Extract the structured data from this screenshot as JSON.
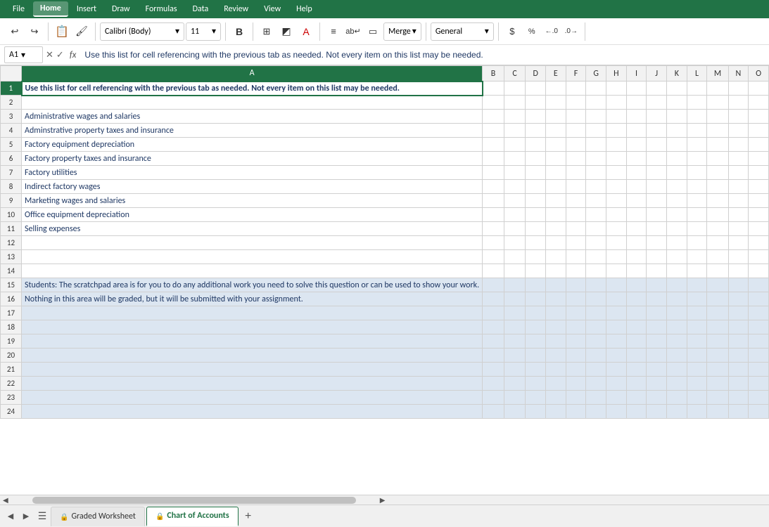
{
  "menuBar": {
    "items": [
      "File",
      "Home",
      "Insert",
      "Draw",
      "Formulas",
      "Data",
      "Review",
      "View",
      "Help"
    ],
    "active": "Home"
  },
  "toolbar": {
    "undo_icon": "↩",
    "redo_icon": "↪",
    "clipboard_icon": "📋",
    "format_painter_icon": "🖌",
    "font_name": "Calibri (Body)",
    "font_size": "11",
    "bold_label": "B",
    "grid_icon": "⊞",
    "highlight_icon": "A",
    "text_color_icon": "A",
    "align_icon": "≡",
    "wrap_icon": "ab",
    "cell_icon": "▭",
    "merge_label": "Merge",
    "format_label": "General",
    "dollar_icon": "$",
    "pct_icon": "%",
    "decimal_icon": ".00"
  },
  "formulaBar": {
    "cellRef": "A1",
    "dropdownIcon": "▾",
    "cancelIcon": "✕",
    "confirmIcon": "✓",
    "fxLabel": "fx",
    "formula": "Use this list for cell referencing with the previous tab as needed. Not every item on this list may be needed."
  },
  "columns": {
    "rowHeader": "",
    "headers": [
      "A",
      "B",
      "C",
      "D",
      "E",
      "F",
      "G",
      "H",
      "I",
      "J",
      "K",
      "L",
      "M",
      "N",
      "O"
    ]
  },
  "rows": [
    {
      "rowNum": "1",
      "isInstruction": true,
      "cells": {
        "A": "Use this list for cell referencing with the previous tab as needed. Not every item on this list may be needed.",
        "B": "",
        "C": "",
        "D": "",
        "E": "",
        "F": "",
        "G": "",
        "H": "",
        "I": "",
        "J": "",
        "K": "",
        "L": "",
        "M": "",
        "N": "",
        "O": ""
      }
    },
    {
      "rowNum": "2",
      "cells": {
        "A": "",
        "B": "",
        "C": "",
        "D": "",
        "E": "",
        "F": "",
        "G": "",
        "H": "",
        "I": "",
        "J": "",
        "K": "",
        "L": "",
        "M": "",
        "N": "",
        "O": ""
      }
    },
    {
      "rowNum": "3",
      "cells": {
        "A": "Administrative wages and salaries",
        "B": "",
        "C": "",
        "D": "",
        "E": "",
        "F": "",
        "G": "",
        "H": "",
        "I": "",
        "J": "",
        "K": "",
        "L": "",
        "M": "",
        "N": "",
        "O": ""
      }
    },
    {
      "rowNum": "4",
      "cells": {
        "A": "Adminstrative property taxes and insurance",
        "B": "",
        "C": "",
        "D": "",
        "E": "",
        "F": "",
        "G": "",
        "H": "",
        "I": "",
        "J": "",
        "K": "",
        "L": "",
        "M": "",
        "N": "",
        "O": ""
      }
    },
    {
      "rowNum": "5",
      "cells": {
        "A": "Factory equipment depreciation",
        "B": "",
        "C": "",
        "D": "",
        "E": "",
        "F": "",
        "G": "",
        "H": "",
        "I": "",
        "J": "",
        "K": "",
        "L": "",
        "M": "",
        "N": "",
        "O": ""
      }
    },
    {
      "rowNum": "6",
      "cells": {
        "A": "Factory property taxes and insurance",
        "B": "",
        "C": "",
        "D": "",
        "E": "",
        "F": "",
        "G": "",
        "H": "",
        "I": "",
        "J": "",
        "K": "",
        "L": "",
        "M": "",
        "N": "",
        "O": ""
      }
    },
    {
      "rowNum": "7",
      "cells": {
        "A": "Factory utilities",
        "B": "",
        "C": "",
        "D": "",
        "E": "",
        "F": "",
        "G": "",
        "H": "",
        "I": "",
        "J": "",
        "K": "",
        "L": "",
        "M": "",
        "N": "",
        "O": ""
      }
    },
    {
      "rowNum": "8",
      "cells": {
        "A": "Indirect factory wages",
        "B": "",
        "C": "",
        "D": "",
        "E": "",
        "F": "",
        "G": "",
        "H": "",
        "I": "",
        "J": "",
        "K": "",
        "L": "",
        "M": "",
        "N": "",
        "O": ""
      }
    },
    {
      "rowNum": "9",
      "cells": {
        "A": "Marketing wages and salaries",
        "B": "",
        "C": "",
        "D": "",
        "E": "",
        "F": "",
        "G": "",
        "H": "",
        "I": "",
        "J": "",
        "K": "",
        "L": "",
        "M": "",
        "N": "",
        "O": ""
      }
    },
    {
      "rowNum": "10",
      "cells": {
        "A": "Office equipment depreciation",
        "B": "",
        "C": "",
        "D": "",
        "E": "",
        "F": "",
        "G": "",
        "H": "",
        "I": "",
        "J": "",
        "K": "",
        "L": "",
        "M": "",
        "N": "",
        "O": ""
      }
    },
    {
      "rowNum": "11",
      "cells": {
        "A": "Selling expenses",
        "B": "",
        "C": "",
        "D": "",
        "E": "",
        "F": "",
        "G": "",
        "H": "",
        "I": "",
        "J": "",
        "K": "",
        "L": "",
        "M": "",
        "N": "",
        "O": ""
      }
    },
    {
      "rowNum": "12",
      "cells": {
        "A": "",
        "B": "",
        "C": "",
        "D": "",
        "E": "",
        "F": "",
        "G": "",
        "H": "",
        "I": "",
        "J": "",
        "K": "",
        "L": "",
        "M": "",
        "N": "",
        "O": ""
      }
    },
    {
      "rowNum": "13",
      "cells": {
        "A": "",
        "B": "",
        "C": "",
        "D": "",
        "E": "",
        "F": "",
        "G": "",
        "H": "",
        "I": "",
        "J": "",
        "K": "",
        "L": "",
        "M": "",
        "N": "",
        "O": ""
      }
    },
    {
      "rowNum": "14",
      "cells": {
        "A": "",
        "B": "",
        "C": "",
        "D": "",
        "E": "",
        "F": "",
        "G": "",
        "H": "",
        "I": "",
        "J": "",
        "K": "",
        "L": "",
        "M": "",
        "N": "",
        "O": ""
      }
    },
    {
      "rowNum": "15",
      "isScratchpad": true,
      "cells": {
        "A": "Students: The scratchpad area is for you to do any additional work you need to solve this question or can be used to show your work.",
        "B": "",
        "C": "",
        "D": "",
        "E": "",
        "F": "",
        "G": "",
        "H": "",
        "I": "",
        "J": "",
        "K": "",
        "L": "",
        "M": "",
        "N": "",
        "O": ""
      }
    },
    {
      "rowNum": "16",
      "isScratchpad": true,
      "cells": {
        "A": "Nothing in this area will be graded, but it will be submitted with your assignment.",
        "B": "",
        "C": "",
        "D": "",
        "E": "",
        "F": "",
        "G": "",
        "H": "",
        "I": "",
        "J": "",
        "K": "",
        "L": "",
        "M": "",
        "N": "",
        "O": ""
      }
    },
    {
      "rowNum": "17",
      "isScratchpadEmpty": true,
      "cells": {
        "A": "",
        "B": "",
        "C": "",
        "D": "",
        "E": "",
        "F": "",
        "G": "",
        "H": "",
        "I": "",
        "J": "",
        "K": "",
        "L": "",
        "M": "",
        "N": "",
        "O": ""
      }
    },
    {
      "rowNum": "18",
      "isScratchpadEmpty": true,
      "cells": {
        "A": "",
        "B": "",
        "C": "",
        "D": "",
        "E": "",
        "F": "",
        "G": "",
        "H": "",
        "I": "",
        "J": "",
        "K": "",
        "L": "",
        "M": "",
        "N": "",
        "O": ""
      }
    },
    {
      "rowNum": "19",
      "isScratchpadEmpty": true,
      "cells": {
        "A": "",
        "B": "",
        "C": "",
        "D": "",
        "E": "",
        "F": "",
        "G": "",
        "H": "",
        "I": "",
        "J": "",
        "K": "",
        "L": "",
        "M": "",
        "N": "",
        "O": ""
      }
    },
    {
      "rowNum": "20",
      "isScratchpadEmpty": true,
      "cells": {
        "A": "",
        "B": "",
        "C": "",
        "D": "",
        "E": "",
        "F": "",
        "G": "",
        "H": "",
        "I": "",
        "J": "",
        "K": "",
        "L": "",
        "M": "",
        "N": "",
        "O": ""
      }
    },
    {
      "rowNum": "21",
      "isScratchpadEmpty": true,
      "cells": {
        "A": "",
        "B": "",
        "C": "",
        "D": "",
        "E": "",
        "F": "",
        "G": "",
        "H": "",
        "I": "",
        "J": "",
        "K": "",
        "L": "",
        "M": "",
        "N": "",
        "O": ""
      }
    },
    {
      "rowNum": "22",
      "isScratchpadEmpty": true,
      "cells": {
        "A": "",
        "B": "",
        "C": "",
        "D": "",
        "E": "",
        "F": "",
        "G": "",
        "H": "",
        "I": "",
        "J": "",
        "K": "",
        "L": "",
        "M": "",
        "N": "",
        "O": ""
      }
    },
    {
      "rowNum": "23",
      "isScratchpadEmpty": true,
      "cells": {
        "A": "",
        "B": "",
        "C": "",
        "D": "",
        "E": "",
        "F": "",
        "G": "",
        "H": "",
        "I": "",
        "J": "",
        "K": "",
        "L": "",
        "M": "",
        "N": "",
        "O": ""
      }
    },
    {
      "rowNum": "24",
      "isScratchpadEmpty": true,
      "cells": {
        "A": "",
        "B": "",
        "C": "",
        "D": "",
        "E": "",
        "F": "",
        "G": "",
        "H": "",
        "I": "",
        "J": "",
        "K": "",
        "L": "",
        "M": "",
        "N": "",
        "O": ""
      }
    }
  ],
  "tabs": [
    {
      "label": "Graded Worksheet",
      "active": false,
      "locked": true
    },
    {
      "label": "Chart of Accounts",
      "active": true,
      "locked": true
    }
  ],
  "colors": {
    "excelGreen": "#217346",
    "selectedCell": "#217346",
    "scratchpadBlue": "#dce6f1",
    "textBlue": "#1f3864",
    "rowHeaderBg": "#f2f2f2",
    "activeColHeader": "#217346"
  }
}
